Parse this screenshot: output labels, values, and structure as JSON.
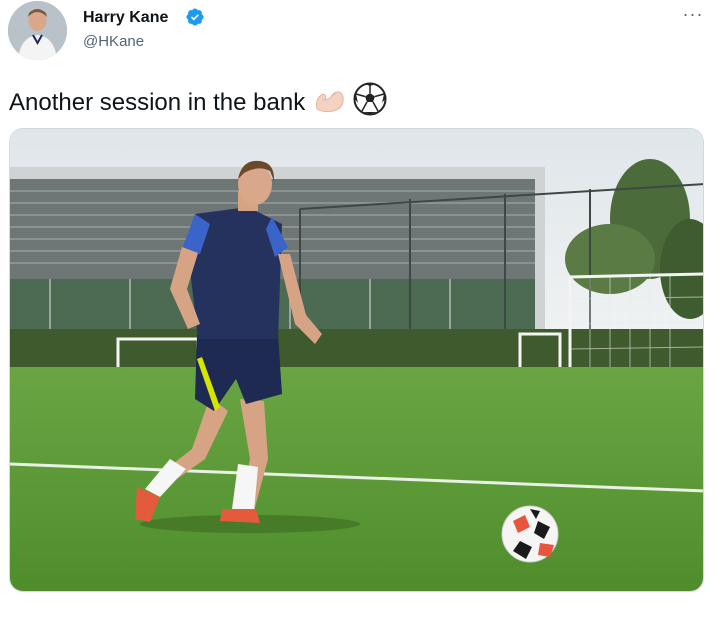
{
  "author": {
    "name": "Harry Kane",
    "handle": "@HKane",
    "verified": true
  },
  "tweet": {
    "text": "Another session in the bank",
    "emojis": [
      "flexed-biceps-light-skin",
      "soccer-ball"
    ]
  },
  "menu": {
    "more_label": "···"
  },
  "colors": {
    "verified_blue": "#1d9bf0",
    "text": "#0f1419",
    "secondary": "#536471",
    "grass": "#5c9a3a"
  }
}
